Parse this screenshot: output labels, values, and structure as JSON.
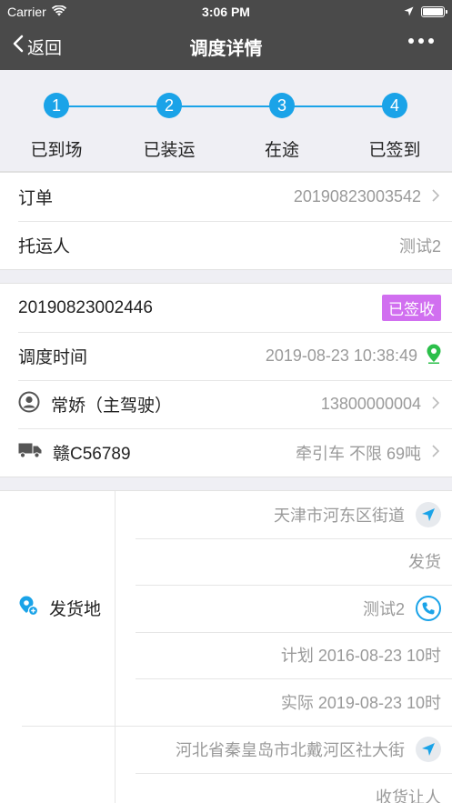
{
  "status_bar": {
    "carrier": "Carrier",
    "time": "3:06 PM"
  },
  "nav": {
    "back_label": "返回",
    "title": "调度详情"
  },
  "steps": [
    {
      "num": "1",
      "label": "已到场"
    },
    {
      "num": "2",
      "label": "已装运"
    },
    {
      "num": "3",
      "label": "在途"
    },
    {
      "num": "4",
      "label": "已签到"
    }
  ],
  "order": {
    "order_label": "订单",
    "order_no": "20190823003542",
    "shipper_label": "托运人",
    "shipper": "测试2"
  },
  "dispatch": {
    "dispatch_no": "20190823002446",
    "status_badge": "已签收",
    "time_label": "调度时间",
    "time": "2019-08-23 10:38:49",
    "driver": "常娇（主驾驶）",
    "driver_phone": "13800000004",
    "plate": "赣C56789",
    "vehicle_info": "牵引车 不限 69吨"
  },
  "shipping": {
    "side_label": "发货地",
    "address": "天津市河东区街道",
    "type": "发货",
    "contact": "测试2",
    "planned": "计划 2016-08-23 10时",
    "actual": "实际 2019-08-23 10时"
  },
  "receiving": {
    "address": "河北省秦皇岛市北戴河区社大街",
    "contact": "收货让人"
  },
  "colors": {
    "accent": "#1aa3e8",
    "badge": "#d16ff0",
    "location_pin": "#2bbf4a",
    "header": "#4a4a4a"
  }
}
